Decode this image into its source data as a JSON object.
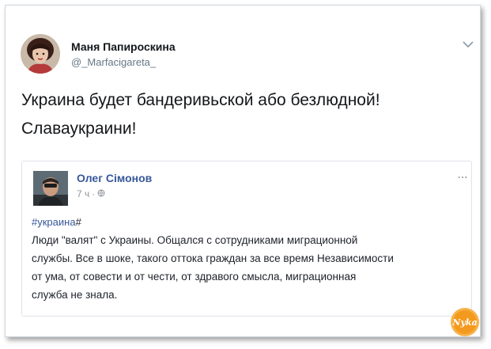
{
  "tweet": {
    "author_name": "Маня Папироскина",
    "author_handle": "@_Marfacigareta_",
    "text_line1": "Украина будет бандеривьской або безлюдной!",
    "text_line2": "Славаукраини!"
  },
  "quoted_post": {
    "author_name": "Олег Сімонов",
    "time": "7 ч",
    "hashtag": "#украина",
    "hashtag_suffix": "#",
    "lines": [
      "Люди \"валят\" с Украины. Общался с сотрудниками миграционной",
      "службы. Все в шоке, такого оттока граждан за все время Независимости",
      "от ума, от совести и от чести, от здравого смысла, миграционная",
      "служба не знала."
    ],
    "more_label": "..."
  },
  "watermark": {
    "text": "Nyka"
  },
  "colors": {
    "name_link": "#365899",
    "watermark_orange": "#f39a1e"
  },
  "icons": {
    "chevron": "chevron-down-icon",
    "globe": "globe-icon",
    "more": "more-icon"
  }
}
